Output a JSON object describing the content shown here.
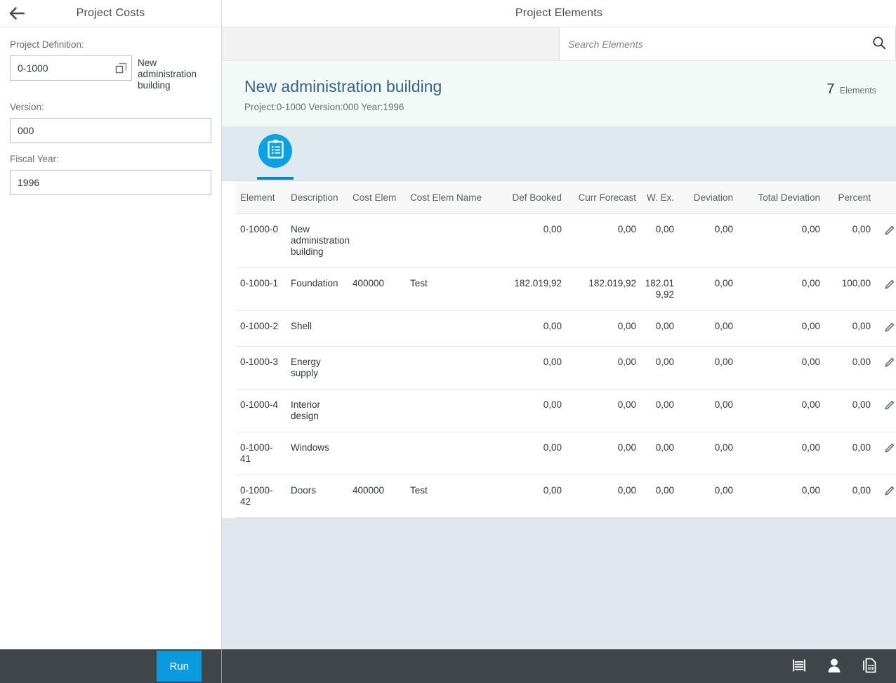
{
  "left_panel": {
    "title": "Project Costs",
    "back_icon": "arrow-left-icon",
    "fields": {
      "project_definition": {
        "label": "Project Definition:",
        "value": "0-1000",
        "placeholder": "",
        "value_help_icon": "value-help-icon",
        "suffix": "New administration building"
      },
      "version": {
        "label": "Version:",
        "value": "000",
        "placeholder": ""
      },
      "fiscal_year": {
        "label": "Fiscal Year:",
        "value": "1996",
        "placeholder": ""
      }
    }
  },
  "right_panel": {
    "title": "Project Elements",
    "search": {
      "placeholder": "Search Elements",
      "value": "",
      "icon": "search-icon"
    },
    "object_header": {
      "title": "New administration building",
      "subtitle": "Project:0-1000 Version:000 Year:1996",
      "count": "7",
      "count_unit": "Elements"
    },
    "icon_tabs": [
      {
        "name": "tab-elements",
        "icon": "clipboard-list-icon",
        "selected": true
      }
    ]
  },
  "table": {
    "columns": [
      {
        "key": "element",
        "label": "Element",
        "align": "left"
      },
      {
        "key": "description",
        "label": "Description",
        "align": "left"
      },
      {
        "key": "cost_elem",
        "label": "Cost Elem",
        "align": "left"
      },
      {
        "key": "cost_elem_name",
        "label": "Cost Elem Name",
        "align": "left"
      },
      {
        "key": "def_booked",
        "label": "Def Booked",
        "align": "right"
      },
      {
        "key": "curr_forecast",
        "label": "Curr Forecast",
        "align": "right"
      },
      {
        "key": "w_ex",
        "label": "W. Ex.",
        "align": "right"
      },
      {
        "key": "deviation",
        "label": "Deviation",
        "align": "right"
      },
      {
        "key": "total_deviation",
        "label": "Total Deviation",
        "align": "right"
      },
      {
        "key": "percent",
        "label": "Percent",
        "align": "right"
      },
      {
        "key": "edit",
        "label": "",
        "align": "center"
      }
    ],
    "rows": [
      {
        "element": "0-1000-0",
        "description": "New administration building",
        "cost_elem": "",
        "cost_elem_name": "",
        "def_booked": "0,00",
        "curr_forecast": "0,00",
        "w_ex": "0,00",
        "deviation": "0,00",
        "total_deviation": "0,00",
        "percent": "0,00",
        "edit_icon": "pencil-icon"
      },
      {
        "element": "0-1000-1",
        "description": "Foundation",
        "cost_elem": "400000",
        "cost_elem_name": "Test",
        "def_booked": "182.019,92",
        "curr_forecast": "182.019,92",
        "w_ex": "182.019,92",
        "deviation": "0,00",
        "total_deviation": "0,00",
        "percent": "100,00",
        "edit_icon": "pencil-icon"
      },
      {
        "element": "0-1000-2",
        "description": "Shell",
        "cost_elem": "",
        "cost_elem_name": "",
        "def_booked": "0,00",
        "curr_forecast": "0,00",
        "w_ex": "0,00",
        "deviation": "0,00",
        "total_deviation": "0,00",
        "percent": "0,00",
        "edit_icon": "pencil-icon"
      },
      {
        "element": "0-1000-3",
        "description": "Energy supply",
        "cost_elem": "",
        "cost_elem_name": "",
        "def_booked": "0,00",
        "curr_forecast": "0,00",
        "w_ex": "0,00",
        "deviation": "0,00",
        "total_deviation": "0,00",
        "percent": "0,00",
        "edit_icon": "pencil-icon"
      },
      {
        "element": "0-1000-4",
        "description": "Interior design",
        "cost_elem": "",
        "cost_elem_name": "",
        "def_booked": "0,00",
        "curr_forecast": "0,00",
        "w_ex": "0,00",
        "deviation": "0,00",
        "total_deviation": "0,00",
        "percent": "0,00",
        "edit_icon": "pencil-icon"
      },
      {
        "element": "0-1000-41",
        "description": "Windows",
        "cost_elem": "",
        "cost_elem_name": "",
        "def_booked": "0,00",
        "curr_forecast": "0,00",
        "w_ex": "0,00",
        "deviation": "0,00",
        "total_deviation": "0,00",
        "percent": "0,00",
        "edit_icon": "pencil-icon"
      },
      {
        "element": "0-1000-42",
        "description": "Doors",
        "cost_elem": "400000",
        "cost_elem_name": "Test",
        "def_booked": "0,00",
        "curr_forecast": "0,00",
        "w_ex": "0,00",
        "deviation": "0,00",
        "total_deviation": "0,00",
        "percent": "0,00",
        "edit_icon": "pencil-icon"
      }
    ]
  },
  "footer": {
    "run_label": "Run",
    "icons": [
      {
        "name": "list-lines-icon"
      },
      {
        "name": "user-icon"
      },
      {
        "name": "spreadsheet-document-icon"
      }
    ]
  },
  "colors": {
    "accent_blue": "#0a9ae0",
    "tab_circle_blue": "#0aa2e3",
    "tab_underline_blue": "#0a84d1",
    "object_title_blue": "#346187",
    "object_header_bg": "#f2faf8",
    "icon_tabbar_bg": "#dfeaef",
    "toolbar_bg": "#f2f2f2",
    "filler_bg": "#e0e6ed",
    "footer_bg": "#3f4549",
    "table_header_bg": "#f7f7f7",
    "text_primary": "#32363a",
    "text_secondary": "#6a6d70"
  }
}
